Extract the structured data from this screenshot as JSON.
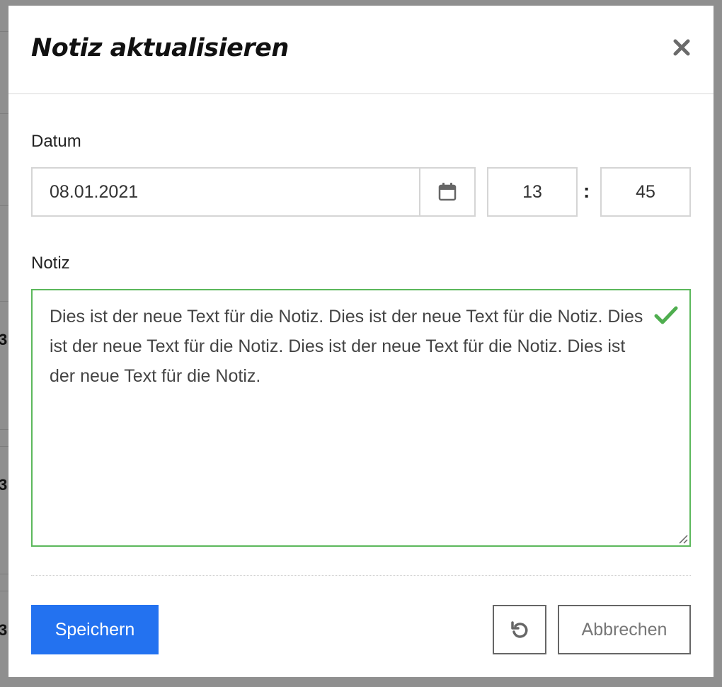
{
  "backdrop": {
    "glyphs": [
      "3",
      "3",
      "3"
    ]
  },
  "modal": {
    "title": "Notiz aktualisieren",
    "close_icon": "close-icon"
  },
  "date_field": {
    "label": "Datum",
    "value": "08.01.2021",
    "calendar_icon": "calendar-icon"
  },
  "time": {
    "hour": "13",
    "separator": ":",
    "minute": "45"
  },
  "note_field": {
    "label": "Notiz",
    "value": "Dies ist der neue Text für die Notiz. Dies ist der neue Text für die Notiz. Dies ist der neue Text für die Notiz. Dies ist der neue Text für die Notiz. Dies ist der neue Text für die Notiz.",
    "valid_icon": "checkmark-icon"
  },
  "actions": {
    "save_label": "Speichern",
    "reset_icon": "reset-icon",
    "cancel_label": "Abbrechen"
  },
  "colors": {
    "primary": "#2372f0",
    "valid": "#5cb85c",
    "backdrop": "#8f8f8f"
  }
}
